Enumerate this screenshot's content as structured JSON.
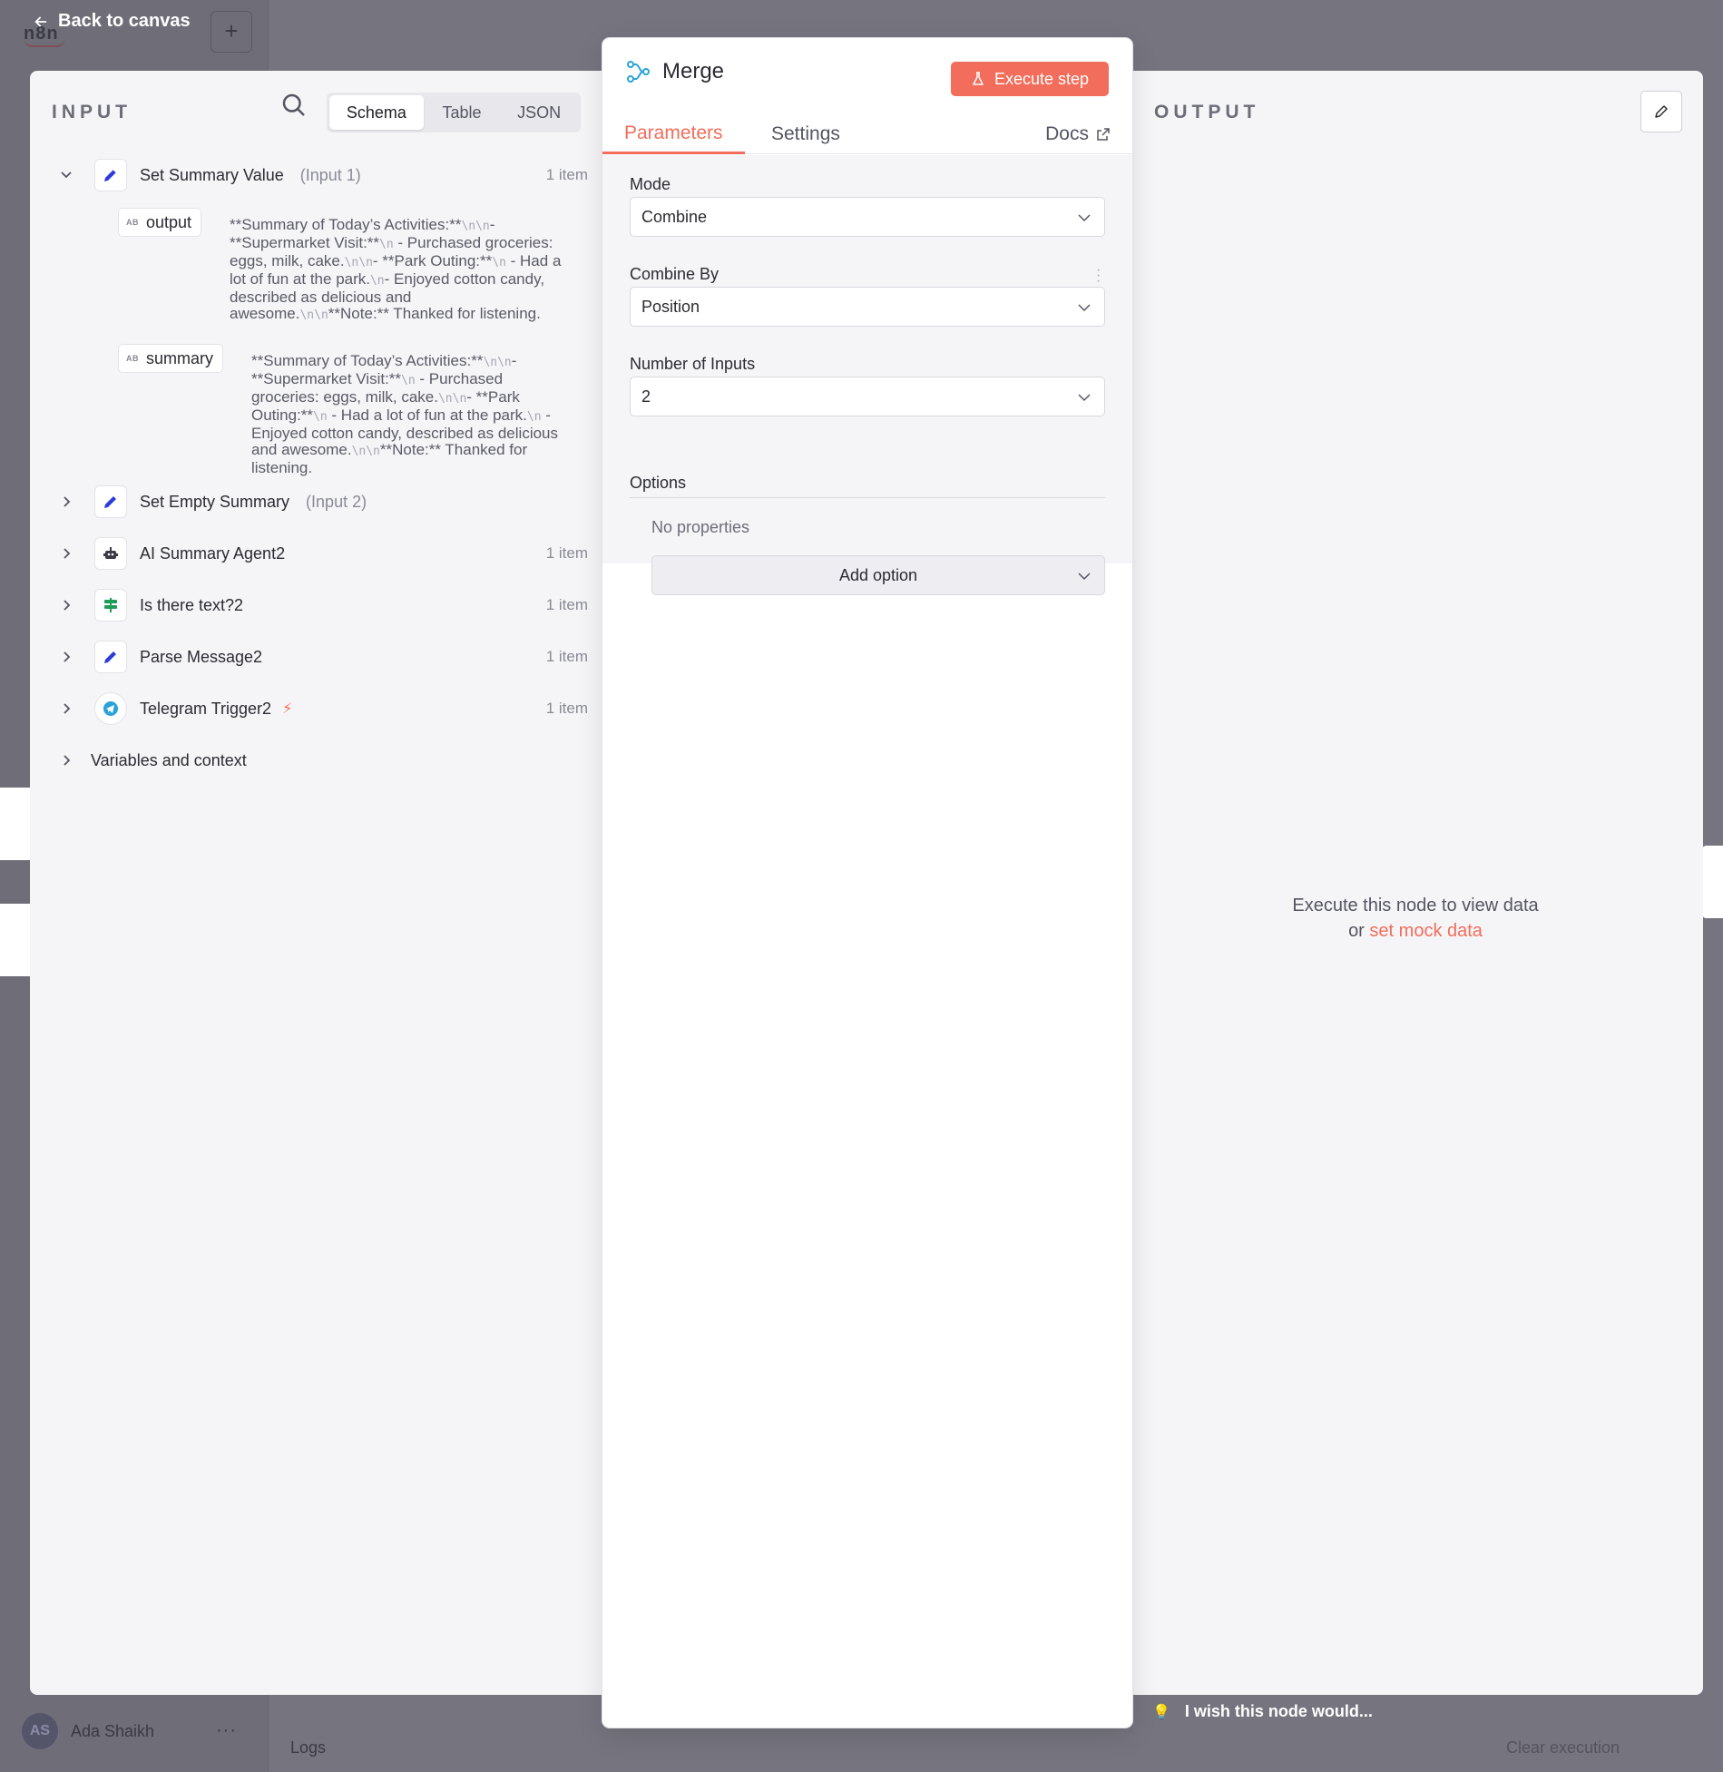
{
  "background": {
    "logo_text": "n8n",
    "user_initials": "AS",
    "user_name": "Ada Shaikh",
    "more_label": "···",
    "logs_label": "Logs",
    "clear_execution_label": "Clear execution",
    "wish_label": "I wish this node would..."
  },
  "nav": {
    "back_label": "Back to canvas"
  },
  "input": {
    "title": "INPUT",
    "view_options": [
      "Schema",
      "Table",
      "JSON"
    ],
    "active_view": "Schema",
    "nodes": [
      {
        "name": "Set Summary Value",
        "sub": "(Input 1)",
        "count": "1 item",
        "icon": "pencil-icon",
        "expanded": true,
        "fields": [
          {
            "type": "AB",
            "name": "output",
            "value_parts": [
              "**Summary of Today’s Activities:**",
              "\\n",
              "\\n",
              "- **Supermarket Visit:**",
              "\\n",
              " - Purchased groceries: eggs, milk, cake.",
              "\\n",
              "\\n",
              "- **Park Outing:**",
              "\\n",
              " - Had a lot of fun at the park.",
              "\\n",
              "- Enjoyed cotton candy, described as delicious and awesome.",
              "\\n",
              "\\n",
              "**Note:** Thanked for listening."
            ]
          },
          {
            "type": "AB",
            "name": "summary",
            "value_parts": [
              "**Summary of Today’s Activities:**",
              "\\n",
              "\\n",
              "- **Supermarket Visit:**",
              "\\n",
              " - Purchased groceries: eggs, milk, cake.",
              "\\n",
              "\\n",
              "- **Park Outing:**",
              "\\n",
              " - Had a lot of fun at the park.",
              "\\n",
              " - Enjoyed cotton candy, described as delicious and awesome.",
              "\\n",
              "\\n",
              "**Note:** Thanked for listening."
            ]
          }
        ]
      },
      {
        "name": "Set Empty Summary",
        "sub": "(Input 2)",
        "count": "",
        "icon": "pencil-icon"
      },
      {
        "name": "AI Summary Agent2",
        "sub": "",
        "count": "1 item",
        "icon": "robot-icon"
      },
      {
        "name": "Is there text?2",
        "sub": "",
        "count": "1 item",
        "icon": "signpost-icon"
      },
      {
        "name": "Parse Message2",
        "sub": "",
        "count": "1 item",
        "icon": "pencil-icon"
      },
      {
        "name": "Telegram Trigger2",
        "sub": "",
        "count": "1 item",
        "icon": "telegram-icon",
        "trigger": true
      }
    ],
    "variables_label": "Variables and context"
  },
  "params": {
    "node_title": "Merge",
    "execute_label": "Execute step",
    "tabs": [
      "Parameters",
      "Settings"
    ],
    "active_tab": "Parameters",
    "docs_label": "Docs",
    "mode_label": "Mode",
    "mode_value": "Combine",
    "combine_by_label": "Combine By",
    "combine_by_value": "Position",
    "num_inputs_label": "Number of Inputs",
    "num_inputs_value": "2",
    "options_label": "Options",
    "no_properties": "No properties",
    "add_option_label": "Add option"
  },
  "output": {
    "title": "OUTPUT",
    "empty_line1": "Execute this node to view data",
    "empty_or": "or",
    "mock_link": "set mock data"
  },
  "colors": {
    "accent": "#f26d5b",
    "pencil": "#2f3bd9",
    "signpost": "#1f9d55",
    "telegram": "#2aa3d9"
  }
}
